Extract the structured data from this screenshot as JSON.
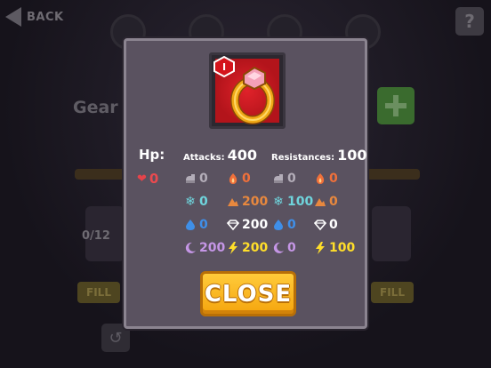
{
  "background": {
    "back_label": "BACK",
    "help_label": "?",
    "gear_title": "Gear C",
    "count_label": "0/12",
    "fill_left": "FILL",
    "fill_right": "FILL",
    "reset_glyph": "↺"
  },
  "item": {
    "icon": "ring-icon",
    "tier_label": "I"
  },
  "hp": {
    "label": "Hp:",
    "value": "0"
  },
  "attacks": {
    "label": "Attacks:",
    "total": "400",
    "physical": "0",
    "fire": "0",
    "ice": "0",
    "earth": "200",
    "water": "0",
    "light": "200",
    "dark": "200",
    "lightning": "200"
  },
  "resistances": {
    "label": "Resistances:",
    "total": "100",
    "physical": "0",
    "fire": "0",
    "ice": "100",
    "earth": "0",
    "water": "0",
    "light": "0",
    "dark": "0",
    "lightning": "100"
  },
  "colors": {
    "physical": "#b3adb8",
    "fire": "#f0703a",
    "ice": "#6fd4dc",
    "earth": "#e8883e",
    "water": "#3f8fe8",
    "light": "#ffffff",
    "dark": "#c596e6",
    "lightning": "#ffde2a",
    "hp": "#ea4a4f"
  },
  "close_label": "CLOSE"
}
